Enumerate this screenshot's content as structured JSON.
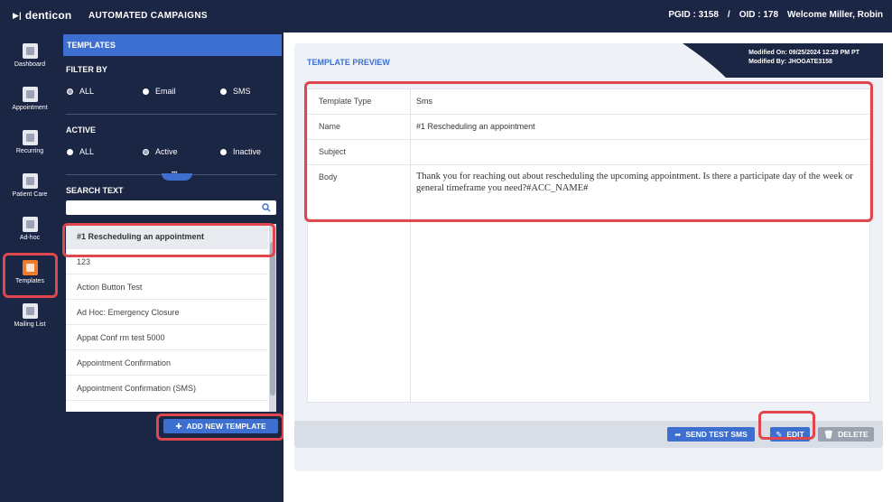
{
  "topbar": {
    "logo": "denticon",
    "title": "AUTOMATED CAMPAIGNS",
    "pgid": "PGID : 3158",
    "separator": "/",
    "oid": "OID : 178",
    "welcome": "Welcome Miller, Robin"
  },
  "nav": {
    "items": [
      {
        "label": "Dashboard",
        "icon": "dashboard-icon"
      },
      {
        "label": "Appointment",
        "icon": "appointment-icon"
      },
      {
        "label": "Recurring",
        "icon": "recurring-icon"
      },
      {
        "label": "Patient Care",
        "icon": "patient-care-icon"
      },
      {
        "label": "Ad-hoc",
        "icon": "ad-hoc-icon"
      },
      {
        "label": "Templates",
        "icon": "templates-icon",
        "active": true
      },
      {
        "label": "Mailing List",
        "icon": "mailing-list-icon"
      }
    ]
  },
  "templates": {
    "header": "TEMPLATES",
    "filter_label": "FILTER BY",
    "filter_options": [
      "ALL",
      "Email",
      "SMS"
    ],
    "filter_selected": "ALL",
    "active_label": "ACTIVE",
    "active_options": [
      "ALL",
      "Active",
      "Inactive"
    ],
    "active_selected": "Active",
    "search_label": "SEARCH TEXT",
    "search_value": "",
    "list": [
      "#1 Rescheduling an appointment",
      "123",
      "Action Button Test",
      "Ad Hoc: Emergency Closure",
      "Appat Conf rm test 5000",
      "Appointment Confirmation",
      "Appointment Confirmation (SMS)"
    ],
    "selected_index": 0,
    "add_button": "ADD NEW TEMPLATE"
  },
  "preview": {
    "title": "TEMPLATE PREVIEW",
    "modified_on": "Modified On: 09/25/2024 12:29 PM PT",
    "modified_by": "Modified By: JHOGATE3158",
    "rows": [
      {
        "key": "Template Type",
        "value": "Sms"
      },
      {
        "key": "Name",
        "value": "#1 Rescheduling an appointment"
      },
      {
        "key": "Subject",
        "value": ""
      },
      {
        "key": "Body",
        "value": "Thank you for reaching out about rescheduling the upcoming appointment. Is there a participate day of the week or general timeframe you need?#ACC_NAME#"
      }
    ],
    "buttons": {
      "send_test": "SEND TEST SMS",
      "edit": "EDIT",
      "delete": "DELETE"
    }
  },
  "colors": {
    "navy": "#1b2544",
    "accent_blue": "#3c6fd0",
    "highlight_red": "#e0474c",
    "templates_orange": "#f07b2a"
  }
}
